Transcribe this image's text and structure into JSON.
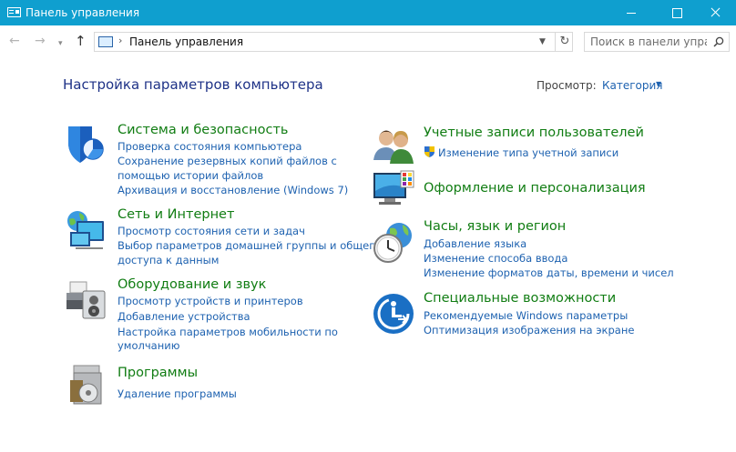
{
  "window": {
    "title": "Панель управления"
  },
  "address": {
    "path": "Панель управления"
  },
  "search": {
    "placeholder": "Поиск в панели упра..."
  },
  "header": {
    "title": "Настройка параметров компьютера",
    "view_label": "Просмотр:",
    "view_value": "Категория"
  },
  "left_categories": [
    {
      "title": "Система и безопасность",
      "links": [
        "Проверка состояния компьютера",
        "Сохранение резервных копий файлов с",
        "помощью истории файлов",
        "Архивация и восстановление (Windows 7)"
      ]
    },
    {
      "title": "Сеть и Интернет",
      "links": [
        "Просмотр состояния сети и задач",
        "Выбор параметров домашней группы и общего",
        "доступа к данным"
      ]
    },
    {
      "title": "Оборудование и звук",
      "links": [
        "Просмотр устройств и принтеров",
        "Добавление устройства",
        "Настройка параметров мобильности по",
        "умолчанию"
      ]
    },
    {
      "title": "Программы",
      "links": [
        "Удаление программы"
      ]
    }
  ],
  "right_categories": [
    {
      "title": "Учетные записи пользователей",
      "links": [
        "Изменение типа учетной записи"
      ]
    },
    {
      "title": "Оформление и персонализация",
      "links": []
    },
    {
      "title": "Часы, язык и регион",
      "links": [
        "Добавление языка",
        "Изменение способа ввода",
        "Изменение форматов даты, времени и чисел"
      ]
    },
    {
      "title": "Специальные возможности",
      "links": [
        "Рекомендуемые Windows параметры",
        "Оптимизация изображения на экране"
      ]
    }
  ],
  "colors": {
    "titlebar": "#0f9fcf",
    "link": "#1e62b0",
    "category": "#117d13",
    "heading": "#1e3287"
  },
  "icons": [
    "control-panel-icon",
    "shield-icon",
    "network-globe-icon",
    "printer-icon",
    "programs-disk-icon",
    "users-icon",
    "uac-shield-icon",
    "display-palette-icon",
    "clock-globe-icon",
    "accessibility-icon"
  ]
}
